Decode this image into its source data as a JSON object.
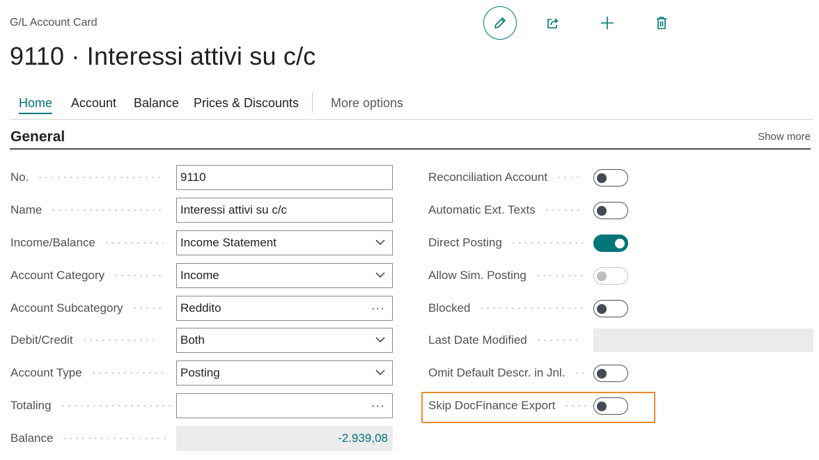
{
  "header": {
    "breadcrumb": "G/L Account Card",
    "title": "9110 · Interessi attivi su c/c"
  },
  "actions": [
    {
      "name": "edit",
      "icon": "pencil-icon"
    },
    {
      "name": "share",
      "icon": "share-icon"
    },
    {
      "name": "new",
      "icon": "plus-icon"
    },
    {
      "name": "delete",
      "icon": "trash-icon"
    }
  ],
  "nav": {
    "tabs": [
      "Home",
      "Account",
      "Balance",
      "Prices & Discounts"
    ],
    "active": "Home",
    "more": "More options"
  },
  "section": {
    "title": "General",
    "show_more": "Show more"
  },
  "left_fields": {
    "no": {
      "label": "No.",
      "value": "9110"
    },
    "name": {
      "label": "Name",
      "value": "Interessi attivi su c/c"
    },
    "income_balance": {
      "label": "Income/Balance",
      "value": "Income Statement"
    },
    "account_category": {
      "label": "Account Category",
      "value": "Income"
    },
    "account_subcategory": {
      "label": "Account Subcategory",
      "value": "Reddito"
    },
    "debit_credit": {
      "label": "Debit/Credit",
      "value": "Both"
    },
    "account_type": {
      "label": "Account Type",
      "value": "Posting"
    },
    "totaling": {
      "label": "Totaling",
      "value": ""
    },
    "balance": {
      "label": "Balance",
      "value": "-2.939,08"
    }
  },
  "right_fields": {
    "reconciliation_account": {
      "label": "Reconciliation Account",
      "on": false
    },
    "automatic_ext_texts": {
      "label": "Automatic Ext. Texts",
      "on": false
    },
    "direct_posting": {
      "label": "Direct Posting",
      "on": true
    },
    "allow_sim_posting": {
      "label": "Allow Sim. Posting",
      "on": false,
      "disabled": true
    },
    "blocked": {
      "label": "Blocked",
      "on": false
    },
    "last_date_modified": {
      "label": "Last Date Modified",
      "value": ""
    },
    "omit_default_descr": {
      "label": "Omit Default Descr. in Jnl.",
      "on": false
    },
    "skip_docfinance_export": {
      "label": "Skip DocFinance Export",
      "on": false,
      "highlighted": true
    }
  },
  "colors": {
    "accent": "#00757a",
    "highlight": "#ec8a2a"
  }
}
